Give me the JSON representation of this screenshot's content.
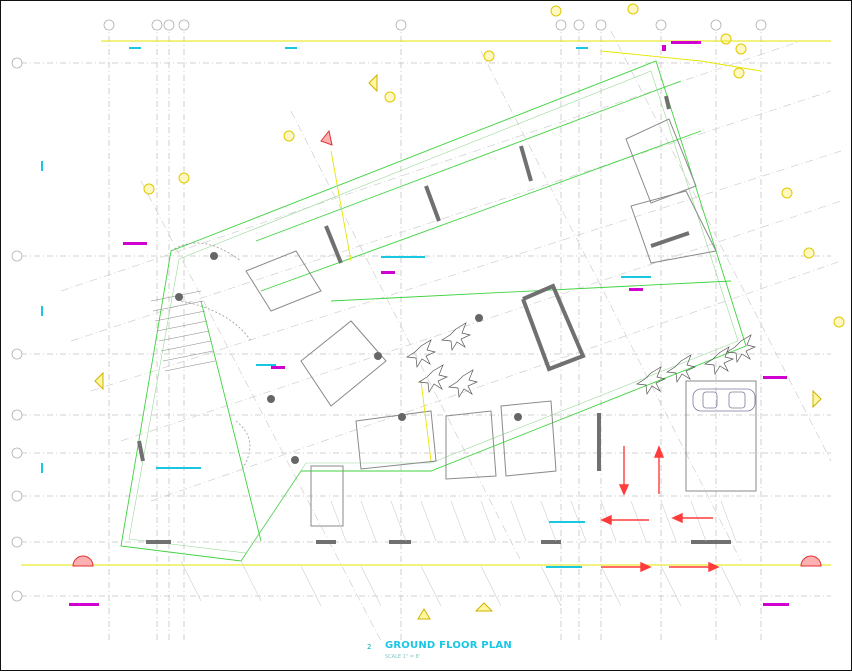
{
  "drawing": {
    "number": "2",
    "title": "GROUND FLOOR PLAN",
    "scale": "SCALE 1\" = 8'"
  },
  "colors": {
    "grid": "#b8b8b8",
    "wall": "#8a8a8a",
    "layer_green": "#3fd33f",
    "layer_yellow": "#e6e600",
    "layer_cyan": "#19c8e0",
    "layer_magenta": "#d000d0",
    "arrow_red": "#ff3b3b",
    "column": "#666666"
  }
}
